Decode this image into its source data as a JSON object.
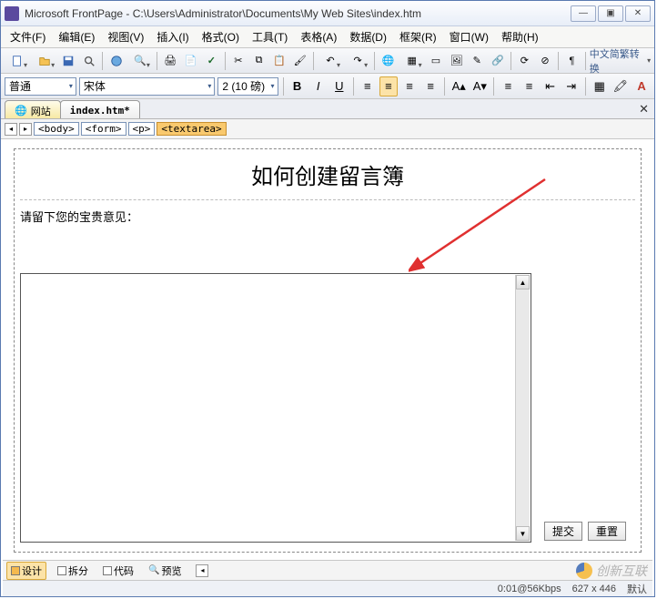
{
  "window": {
    "app_name": "Microsoft FrontPage",
    "title_path": "C:\\Users\\Administrator\\Documents\\My Web Sites\\index.htm"
  },
  "winbuttons": {
    "min": "—",
    "max": "▣",
    "close": "✕"
  },
  "menus": [
    "文件(F)",
    "编辑(E)",
    "视图(V)",
    "插入(I)",
    "格式(O)",
    "工具(T)",
    "表格(A)",
    "数据(D)",
    "框架(R)",
    "窗口(W)",
    "帮助(H)"
  ],
  "toolbar2_label": "中文简繁转换",
  "format": {
    "style": "普通",
    "font": "宋体",
    "size": "2 (10 磅)",
    "bold": "B",
    "italic": "I",
    "underline": "U"
  },
  "tabs": {
    "site": "网站",
    "file": "index.htm*"
  },
  "breadcrumb": [
    "<body>",
    "<form>",
    "<p>",
    "<textarea>"
  ],
  "page": {
    "heading": "如何创建留言簿",
    "prompt": "请留下您的宝贵意见：",
    "submit": "提交",
    "reset": "重置"
  },
  "viewmodes": {
    "design": "设计",
    "split": "拆分",
    "code": "代码",
    "preview": "预览"
  },
  "status": {
    "speed": "0:01@56Kbps",
    "dims": "627 x 446",
    "mode": "默认"
  },
  "watermark": "创新互联"
}
